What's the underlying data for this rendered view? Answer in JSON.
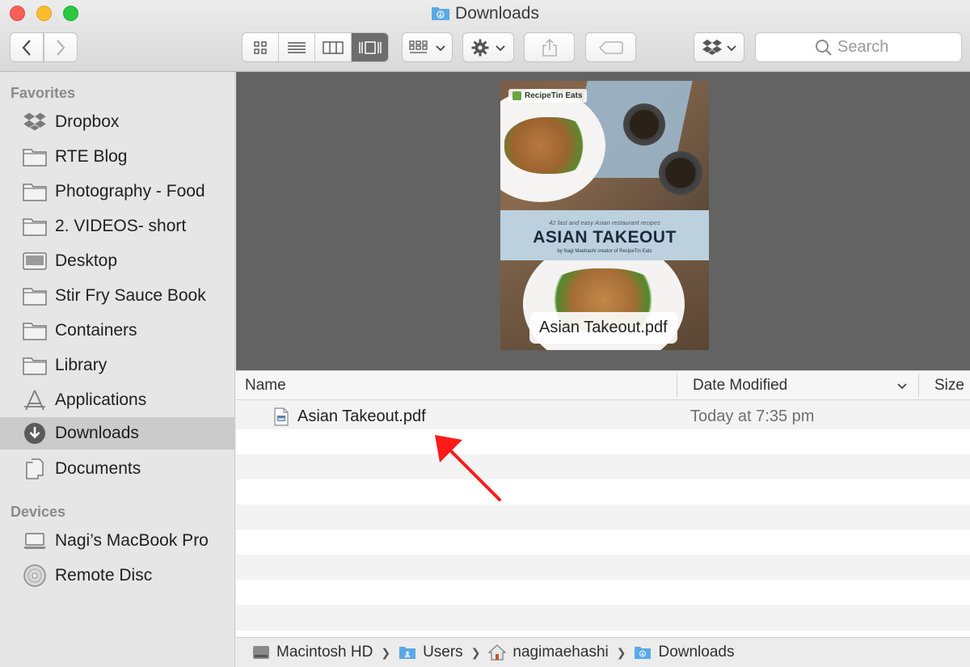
{
  "window": {
    "title": "Downloads"
  },
  "toolbar": {
    "search_placeholder": "Search"
  },
  "sidebar": {
    "favorites_header": "Favorites",
    "devices_header": "Devices",
    "favorites": [
      {
        "label": "Dropbox",
        "icon": "dropbox-icon"
      },
      {
        "label": "RTE Blog",
        "icon": "folder-icon"
      },
      {
        "label": "Photography - Food",
        "icon": "folder-icon"
      },
      {
        "label": "2. VIDEOS- short",
        "icon": "folder-icon"
      },
      {
        "label": "Desktop",
        "icon": "desktop-folder-icon"
      },
      {
        "label": "Stir Fry Sauce Book",
        "icon": "folder-icon"
      },
      {
        "label": "Containers",
        "icon": "folder-icon"
      },
      {
        "label": "Library",
        "icon": "folder-icon"
      },
      {
        "label": "Applications",
        "icon": "applications-icon"
      },
      {
        "label": "Downloads",
        "icon": "downloads-icon",
        "selected": true
      },
      {
        "label": "Documents",
        "icon": "documents-icon"
      }
    ],
    "devices": [
      {
        "label": "Nagi’s MacBook Pro",
        "icon": "laptop-icon"
      },
      {
        "label": "Remote Disc",
        "icon": "disc-icon"
      }
    ]
  },
  "preview": {
    "file_label": "Asian Takeout.pdf",
    "cover": {
      "brand": "RecipeTin Eats",
      "subtitle": "42 fast and easy Asian restaurant recipes",
      "title": "ASIAN TAKEOUT",
      "byline": "by Nagi Maehashi creator of RecipeTin Eats"
    }
  },
  "list": {
    "columns": {
      "name": "Name",
      "date": "Date Modified",
      "size": "Size"
    },
    "files": [
      {
        "name": "Asian Takeout.pdf",
        "date": "Today at 7:35 pm"
      }
    ]
  },
  "pathbar": {
    "crumbs": [
      "Macintosh HD",
      "Users",
      "nagimaehashi",
      "Downloads"
    ]
  },
  "colors": {
    "annotation_arrow": "#ff1a1a",
    "selected_sidebar": "#cbcbcb",
    "folder_blue": "#5aa9e6"
  }
}
